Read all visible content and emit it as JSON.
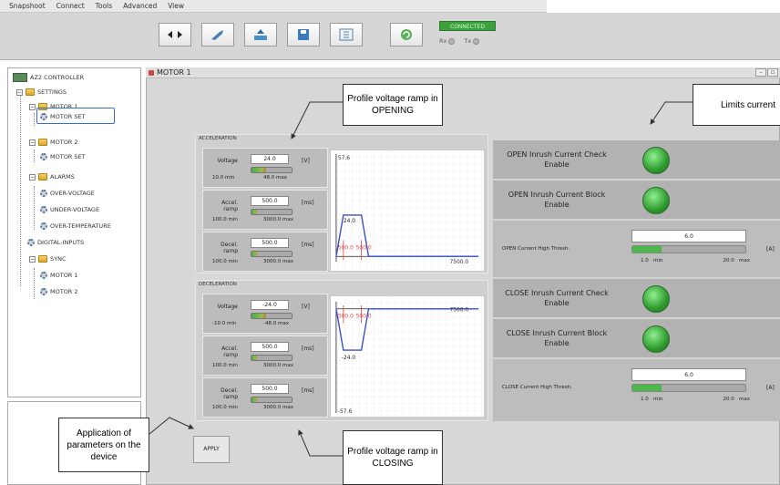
{
  "menu": [
    "Snapshoot",
    "Connect",
    "Tools",
    "Advanced",
    "View"
  ],
  "toolbar": {
    "connection_status": "CONNECTED",
    "rx_label": "Rx",
    "tx_label": "Tx"
  },
  "tree": {
    "root": "AZ2 CONTROLLER",
    "settings": "SETTINGS",
    "motor1": "MOTOR 1",
    "motor1_set": "MOTOR SET",
    "motor2": "MOTOR 2",
    "motor2_set": "MOTOR SET",
    "alarms": "ALARMS",
    "over_voltage": "OVER-VOLTAGE",
    "under_voltage": "UNDER-VOLTAGE",
    "over_temp": "OVER-TEMPERATURE",
    "digital_inputs": "DIGITAL-INPUTS",
    "sync": "SYNC",
    "sync_m1": "MOTOR 1",
    "sync_m2": "MOTOR 2"
  },
  "main_title": "MOTOR 1",
  "acceleration": {
    "section": "ACCELERATION",
    "voltage": {
      "label": "Voltage",
      "value": "24.0",
      "unit": "[V]",
      "min": "10.0",
      "max": "48.0",
      "min_label": "min",
      "max_label": "max",
      "fill": 0.37
    },
    "accel_ramp": {
      "label": "Accel. ramp",
      "value": "500.0",
      "unit": "[ms]",
      "min": "100.0",
      "max": "3000.0",
      "min_label": "min",
      "max_label": "max",
      "fill": 0.14
    },
    "decel_ramp": {
      "label": "Decel. ramp",
      "value": "500.0",
      "unit": "[ms]",
      "min": "100.0",
      "max": "3000.0",
      "min_label": "min",
      "max_label": "max",
      "fill": 0.14
    }
  },
  "deceleration": {
    "section": "DECELERATION",
    "voltage": {
      "label": "Voltage",
      "value": "-24.0",
      "unit": "[V]",
      "min": "-10.0",
      "max": "-48.0",
      "min_label": "min",
      "max_label": "max",
      "fill": 0.37
    },
    "accel_ramp": {
      "label": "Accel. ramp",
      "value": "500.0",
      "unit": "[ms]",
      "min": "100.0",
      "max": "3000.0",
      "min_label": "min",
      "max_label": "max",
      "fill": 0.14
    },
    "decel_ramp": {
      "label": "Decel. ramp",
      "value": "500.0",
      "unit": "[ms]",
      "min": "100.0",
      "max": "3000.0",
      "min_label": "min",
      "max_label": "max",
      "fill": 0.14
    }
  },
  "chart_open": {
    "ymax_label": "57.6",
    "x_end_label": "7500.0",
    "level_label": "24.0",
    "ramp_label_1": "500.0",
    "ramp_label_2": "500.0"
  },
  "chart_close": {
    "ymin_label": "-57.6",
    "x_end_label": "7500.0",
    "level_label": "-24.0",
    "ramp_label_1": "500.0",
    "ramp_label_2": "500.0"
  },
  "right": {
    "open_check": "OPEN Inrush Current Check Enable",
    "open_block": "OPEN Inrush Current Block Enable",
    "open_thresh": {
      "label": "OPEN Current High Thresh.",
      "value": "6.0",
      "unit": "[A]",
      "min": "1.0",
      "max": "20.0",
      "min_label": "min",
      "max_label": "max",
      "fill": 0.26
    },
    "close_check": "CLOSE Inrush Current Check Enable",
    "close_block": "CLOSE Inrush Current Block Enable",
    "close_thresh": {
      "label": "CLOSE Current High Thresh.",
      "value": "6.0",
      "unit": "[A]",
      "min": "1.0",
      "max": "20.0",
      "min_label": "min",
      "max_label": "max",
      "fill": 0.26
    }
  },
  "apply_label": "APPLY",
  "callouts": {
    "opening": "Profile voltage ramp in OPENING",
    "limits": "Limits current",
    "apply": "Application of parameters on the device",
    "closing": "Profile voltage ramp in CLOSING"
  },
  "colors": {
    "led_on": "#2e9a2e",
    "connected": "#3ca03c",
    "selection": "#3a6fc9",
    "ramp_line": "#3b4fc0",
    "ramp_marker": "#d44"
  }
}
